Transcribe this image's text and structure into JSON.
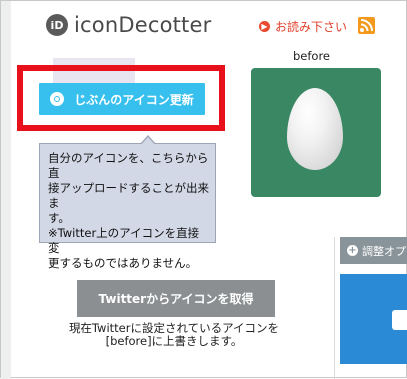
{
  "header": {
    "logo_mark": "iD",
    "logo_text": "iconDecotter",
    "read_link": "お読み下さい",
    "read_icon": "right-arrow-circle-icon",
    "rss_icon": "rss-icon"
  },
  "upload": {
    "button_label": "じぶんのアイコン更新",
    "button_icon": "camera-icon",
    "tooltip_lines": [
      "自分のアイコンを、こちらから直",
      "接アップロードすることが出来ま",
      "す。",
      "※Twitter上のアイコンを直接変",
      "更するものではありません。"
    ]
  },
  "preview": {
    "label": "before",
    "avatar": "default-egg-avatar"
  },
  "twitter": {
    "button_label": "Twitterからアイコンを取得",
    "note_lines": [
      "現在Twitterに設定されているアイコンを",
      "[before]に上書きします。"
    ]
  },
  "right_panel": {
    "adjust_label": "調整オプ",
    "adjust_icon": "plus-circle-icon"
  },
  "colors": {
    "upload_button": "#37c0ee",
    "highlight_frame": "#e8101a",
    "avatar_bg": "#3a8763",
    "twitter_button": "#8b8f91",
    "blue_panel": "#2a8ad6",
    "rss": "#f39a1e"
  }
}
